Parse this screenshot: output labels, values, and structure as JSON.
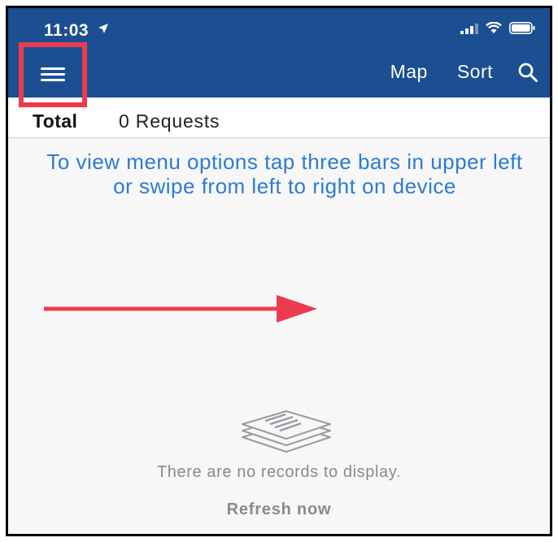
{
  "status_bar": {
    "time": "11:03"
  },
  "nav": {
    "map_label": "Map",
    "sort_label": "Sort"
  },
  "totals": {
    "label": "Total",
    "value": "0 Requests"
  },
  "hint_text": "To view menu options tap three bars in upper left or swipe from left to right on device",
  "empty_state": {
    "message": "There are no records to display.",
    "refresh_label": "Refresh now"
  },
  "colors": {
    "header": "#1b4f92",
    "hint": "#2b7bd6",
    "annotation": "#ec3b4e",
    "muted": "#8a8a8e"
  },
  "icons": [
    "location-arrow-icon",
    "signal-icon",
    "wifi-icon",
    "battery-icon",
    "hamburger-menu-icon",
    "search-icon",
    "documents-stack-icon",
    "annotation-arrow"
  ]
}
